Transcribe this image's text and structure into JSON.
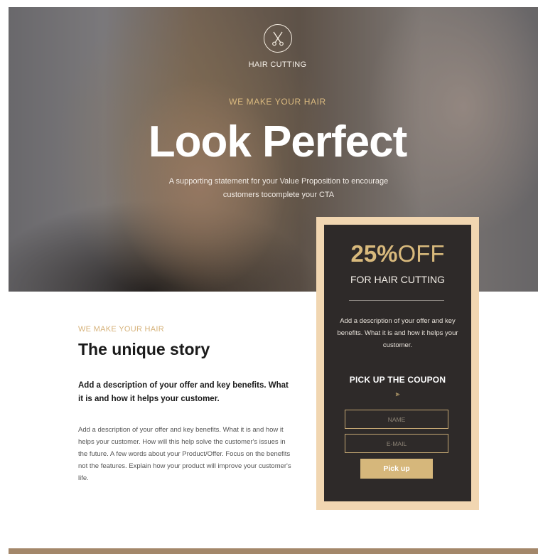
{
  "hero": {
    "brand": "HAIR CUTTING",
    "tagline": "WE MAKE YOUR HAIR",
    "headline": "Look Perfect",
    "subline": "A supporting statement for your Value Proposition to encourage customers tocomplete your CTA",
    "logo_icon": "scissors-icon"
  },
  "story": {
    "kicker": "WE MAKE YOUR HAIR",
    "title": "The unique story",
    "lead": "Add a description of your offer and key benefits. What it is and how it helps your customer.",
    "body": "Add a description of your offer and key benefits. What it is and how it helps your customer. How will this help solve the customer's issues in the future. A few words about your Product/Offer. Focus on the benefits not the features. Explain how your product will improve your customer's life."
  },
  "coupon": {
    "percent": "25%",
    "off": "OFF",
    "for_text": "FOR HAIR CUTTING",
    "description": "Add a description of your offer and key benefits. What it is and how it helps your customer.",
    "heading": "PICK UP THE COUPON",
    "chevron_icon": "double-chevron-down-icon",
    "name_placeholder": "NAME",
    "email_placeholder": "E-MAIL",
    "button_label": "Pick up"
  },
  "colors": {
    "accent": "#d6b77b",
    "coupon_bg": "#2e2a29",
    "coupon_frame": "#f1d6b1",
    "footer": "#a3876a"
  }
}
